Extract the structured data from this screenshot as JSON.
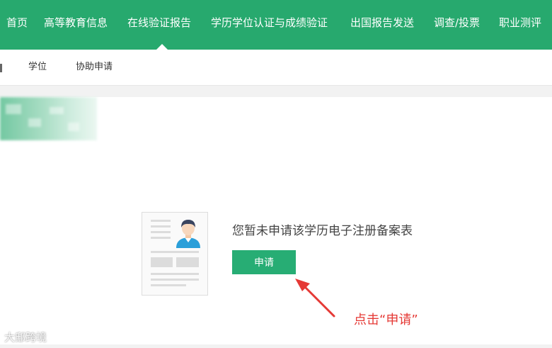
{
  "top_nav": {
    "items": [
      "首页",
      "高等教育信息",
      "在线验证报告",
      "学历学位认证与成绩验证",
      "出国报告发送",
      "调查/投票",
      "职业测评"
    ],
    "active_index": 2
  },
  "sub_nav": {
    "items": [
      "学位",
      "协助申请"
    ]
  },
  "main": {
    "empty_message": "您暂未申请该学历电子注册备案表",
    "apply_button": "申请"
  },
  "annotation": {
    "hint": "点击“申请”"
  },
  "watermark": "大邸跨境",
  "colors": {
    "brand_green": "#27a96e",
    "button_green": "#27ad74",
    "annotation_red": "#e53935",
    "avatar_shirt": "#2b9fd9",
    "avatar_hair": "#3a4560"
  },
  "icons": {
    "illustration": "resume-avatar-illustration",
    "arrow": "red-arrow-pointer"
  }
}
